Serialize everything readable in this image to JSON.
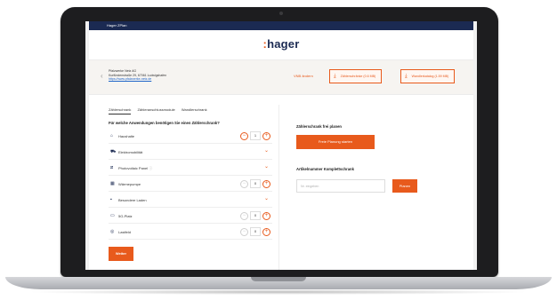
{
  "window": {
    "app_title": "Hager ZPlan"
  },
  "brand": {
    "name": "hager",
    "prefix": ":"
  },
  "company": {
    "name": "Pfalzwerke Netz AG",
    "address": "Kurfürstenstraße 29, 67061 Ludwigshafen",
    "website": "https://www.pfalzwerke-netz.de",
    "change_link": "VNB ändern",
    "download_1": "Zählerschränke (0.6 MB)",
    "download_2": "Wandlerkatalog (1.59 MB)"
  },
  "tabs": [
    {
      "label": "Zählerschrank",
      "active": true
    },
    {
      "label": "Zähleranschlussmodule",
      "active": false
    },
    {
      "label": "Wandlerschrank",
      "active": false
    }
  ],
  "question": "Für welche Anwendungen benötigen Sie einen Zählerschrank?",
  "rows": [
    {
      "icon": "house-icon",
      "label": "Haushalte",
      "value": "1"
    },
    {
      "icon": "car-icon",
      "label": "Elektromobilität"
    },
    {
      "icon": "solar-panel-icon",
      "label": "Photovoltaic Panel"
    },
    {
      "icon": "heat-pump-icon",
      "label": "Wärmepumpe",
      "value": "0"
    },
    {
      "icon": "shop-icon",
      "label": "Besondere Laden"
    },
    {
      "icon": "parking-icon",
      "label": "5G-Platz",
      "value": "0"
    },
    {
      "icon": "charger-icon",
      "label": "Lastfeld",
      "value": "0"
    }
  ],
  "weiter_button": "Weiter",
  "right": {
    "plan_title": "Zählerschrank frei planen",
    "plan_button": "Freie Planung starten",
    "article_title": "Artikelnummer Komplettschrank",
    "article_placeholder": "Nr. eingeben",
    "plan_submit": "Planen"
  },
  "colors": {
    "accent": "#e85a1c",
    "navy": "#1b2a52"
  }
}
